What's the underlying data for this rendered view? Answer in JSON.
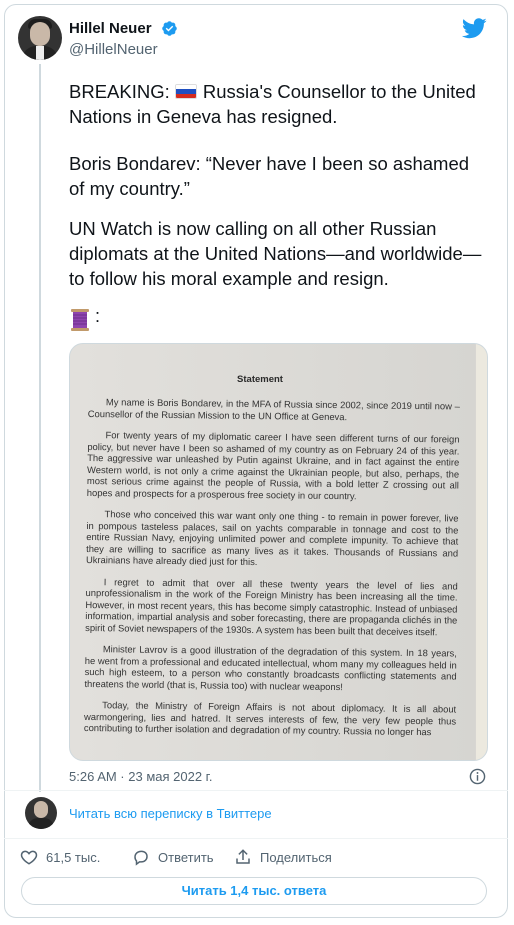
{
  "author": {
    "name": "Hillel Neuer",
    "handle": "@HillelNeuer",
    "verified": true
  },
  "tweet": {
    "paragraph_1": "Russia's Counsellor to the United Nations in Geneva has resigned.",
    "paragraph_1_prefix": "BREAKING:",
    "paragraph_2": "Boris Bondarev: “Never have I been so ashamed of my country.”",
    "paragraph_3": "UN Watch is now calling on all other Russian diplomats at the United Nations—and worldwide—to follow his moral example and resign.",
    "emoji_suffix": ":"
  },
  "statement": {
    "title": "Statement",
    "paragraphs": [
      "My name is Boris Bondarev, in the MFA of Russia since 2002, since 2019 until now – Counsellor of the Russian Mission to the UN Office at Geneva.",
      "For twenty years of my diplomatic career I have seen different turns of our foreign policy, but never have I been so ashamed of my country as on February 24 of this year. The aggressive war unleashed by Putin against Ukraine, and in fact against the entire Western world, is not only a crime against the Ukrainian people, but also, perhaps, the most serious crime against the people of Russia, with a bold letter Z crossing out all hopes and prospects for a prosperous free society in our country.",
      "Those who conceived this war want only one thing - to remain in power forever, live in pompous tasteless palaces, sail on yachts comparable in tonnage and cost to the entire Russian Navy, enjoying unlimited power and complete impunity. To achieve that they are willing to sacrifice as many lives as it takes. Thousands of Russians and Ukrainians have already died just for this.",
      "I regret to admit that over all these twenty years the level of lies and unprofessionalism in the work of the Foreign Ministry has been increasing all the time. However, in most recent years, this has become simply catastrophic. Instead of unbiased information, impartial analysis and sober forecasting, there are propaganda clichés in the spirit of Soviet newspapers of the 1930s. A system has been built that deceives itself.",
      "Minister Lavrov is a good illustration of the degradation of this system. In 18 years, he went from a professional and educated intellectual, whom many my colleagues held in such high esteem, to a person who constantly broadcasts conflicting statements and threatens the world (that is, Russia too) with nuclear weapons!",
      "Today, the Ministry of Foreign Affairs is not about diplomacy. It is all about warmongering, lies and hatred. It serves interests of few, the very few people thus contributing to further isolation and degradation of my country. Russia no longer has"
    ]
  },
  "timestamp": "5:26 AM · 23 мая 2022 г.",
  "read_thread": "Читать всю переписку в Твиттере",
  "actions": {
    "likes": "61,5 тыс.",
    "reply": "Ответить",
    "share": "Поделиться"
  },
  "replies_button": "Читать 1,4 тыс. ответа",
  "colors": {
    "accent": "#1d9bf0",
    "like": "#f91880",
    "muted": "#536471"
  },
  "icons": [
    "verified-badge-icon",
    "twitter-bird-icon",
    "russian-flag-icon",
    "thread-spool-icon",
    "info-icon",
    "heart-icon",
    "reply-icon",
    "share-icon"
  ]
}
